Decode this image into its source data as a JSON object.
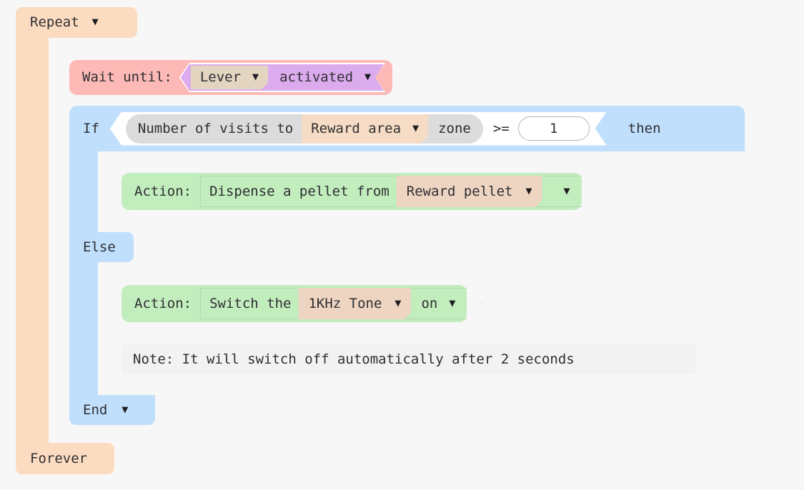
{
  "program": {
    "loop": {
      "start_label": "Repeat",
      "end_label": "Forever",
      "caret": "▼",
      "color": "#fcdcc0"
    },
    "wait": {
      "label": "Wait until:",
      "source": "Lever",
      "state": "activated",
      "caret": "▼",
      "color": "#fcb9b5",
      "condition_color": "#dcabee",
      "chip_color": "#e3d5c0"
    },
    "conditional": {
      "if_label": "If",
      "else_label": "Else",
      "end_label": "End",
      "then_label": "then",
      "caret": "▼",
      "color": "#bfdffc",
      "condition": {
        "prefix": "Number of visits to",
        "target": "Reward area",
        "suffix": "zone",
        "operator": ">=",
        "value": "1"
      }
    },
    "then_branch": {
      "action": {
        "label": "Action:",
        "verb": "Dispense a pellet from",
        "device": "Reward pellet",
        "option": "",
        "caret": "▼",
        "color": "#c2edbd",
        "chip_color": "#eed5c2"
      }
    },
    "else_branch": {
      "action": {
        "label": "Action:",
        "verb": "Switch the",
        "device": "1KHz Tone",
        "option": "on",
        "caret": "▼",
        "color": "#c2edbd",
        "chip_color": "#eed5c2"
      },
      "note": "Note: It will switch off automatically after 2 seconds"
    }
  }
}
